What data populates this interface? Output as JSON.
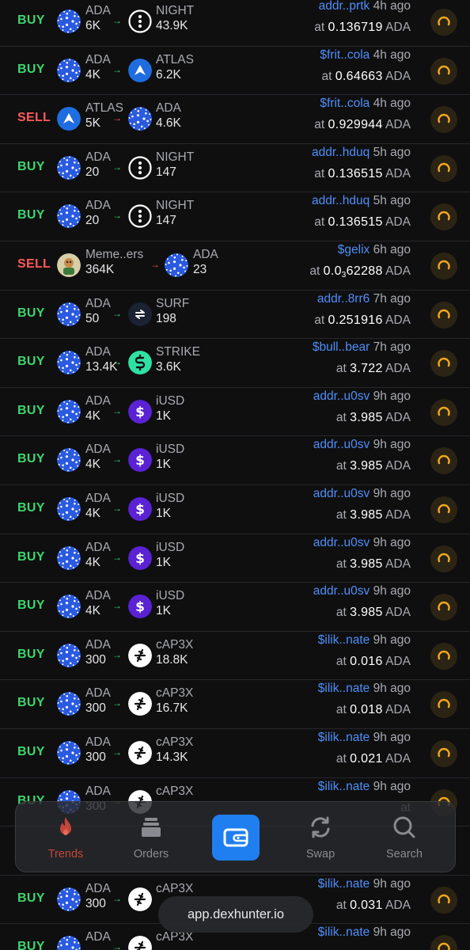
{
  "trades": [
    {
      "side": "BUY",
      "from": {
        "sym": "ADA",
        "amt": "6K",
        "icon": "ada"
      },
      "to": {
        "sym": "NIGHT",
        "amt": "43.9K",
        "icon": "night"
      },
      "addr": "addr..prtk",
      "ago": "4h ago",
      "at": "at",
      "price": "0.136719",
      "unit": "ADA"
    },
    {
      "side": "BUY",
      "from": {
        "sym": "ADA",
        "amt": "4K",
        "icon": "ada"
      },
      "to": {
        "sym": "ATLAS",
        "amt": "6.2K",
        "icon": "atlas"
      },
      "addr": "$frit..cola",
      "ago": "4h ago",
      "at": "at",
      "price": "0.64663",
      "unit": "ADA"
    },
    {
      "side": "SELL",
      "from": {
        "sym": "ATLAS",
        "amt": "5K",
        "icon": "atlas"
      },
      "to": {
        "sym": "ADA",
        "amt": "4.6K",
        "icon": "ada"
      },
      "addr": "$frit..cola",
      "ago": "4h ago",
      "at": "at",
      "price": "0.929944",
      "unit": "ADA"
    },
    {
      "side": "BUY",
      "from": {
        "sym": "ADA",
        "amt": "20",
        "icon": "ada"
      },
      "to": {
        "sym": "NIGHT",
        "amt": "147",
        "icon": "night"
      },
      "addr": "addr..hduq",
      "ago": "5h ago",
      "at": "at",
      "price": "0.136515",
      "unit": "ADA"
    },
    {
      "side": "BUY",
      "from": {
        "sym": "ADA",
        "amt": "20",
        "icon": "ada"
      },
      "to": {
        "sym": "NIGHT",
        "amt": "147",
        "icon": "night"
      },
      "addr": "addr..hduq",
      "ago": "5h ago",
      "at": "at",
      "price": "0.136515",
      "unit": "ADA"
    },
    {
      "side": "SELL",
      "from": {
        "sym": "Meme..ers",
        "amt": "364K",
        "icon": "meme"
      },
      "to": {
        "sym": "ADA",
        "amt": "23",
        "icon": "ada"
      },
      "addr": "$gelix",
      "ago": "6h ago",
      "at": "at",
      "price": "0.0",
      "price_sub": "3",
      "price_tail": "62288",
      "unit": "ADA"
    },
    {
      "side": "BUY",
      "from": {
        "sym": "ADA",
        "amt": "50",
        "icon": "ada"
      },
      "to": {
        "sym": "SURF",
        "amt": "198",
        "icon": "surf"
      },
      "addr": "addr..8rr6",
      "ago": "7h ago",
      "at": "at",
      "price": "0.251916",
      "unit": "ADA"
    },
    {
      "side": "BUY",
      "from": {
        "sym": "ADA",
        "amt": "13.4K",
        "icon": "ada"
      },
      "to": {
        "sym": "STRIKE",
        "amt": "3.6K",
        "icon": "strike"
      },
      "addr": "$bull..bear",
      "ago": "7h ago",
      "at": "at",
      "price": "3.722",
      "unit": "ADA"
    },
    {
      "side": "BUY",
      "from": {
        "sym": "ADA",
        "amt": "4K",
        "icon": "ada"
      },
      "to": {
        "sym": "iUSD",
        "amt": "1K",
        "icon": "iusd"
      },
      "addr": "addr..u0sv",
      "ago": "9h ago",
      "at": "at",
      "price": "3.985",
      "unit": "ADA"
    },
    {
      "side": "BUY",
      "from": {
        "sym": "ADA",
        "amt": "4K",
        "icon": "ada"
      },
      "to": {
        "sym": "iUSD",
        "amt": "1K",
        "icon": "iusd"
      },
      "addr": "addr..u0sv",
      "ago": "9h ago",
      "at": "at",
      "price": "3.985",
      "unit": "ADA"
    },
    {
      "side": "BUY",
      "from": {
        "sym": "ADA",
        "amt": "4K",
        "icon": "ada"
      },
      "to": {
        "sym": "iUSD",
        "amt": "1K",
        "icon": "iusd"
      },
      "addr": "addr..u0sv",
      "ago": "9h ago",
      "at": "at",
      "price": "3.985",
      "unit": "ADA"
    },
    {
      "side": "BUY",
      "from": {
        "sym": "ADA",
        "amt": "4K",
        "icon": "ada"
      },
      "to": {
        "sym": "iUSD",
        "amt": "1K",
        "icon": "iusd"
      },
      "addr": "addr..u0sv",
      "ago": "9h ago",
      "at": "at",
      "price": "3.985",
      "unit": "ADA"
    },
    {
      "side": "BUY",
      "from": {
        "sym": "ADA",
        "amt": "4K",
        "icon": "ada"
      },
      "to": {
        "sym": "iUSD",
        "amt": "1K",
        "icon": "iusd"
      },
      "addr": "addr..u0sv",
      "ago": "9h ago",
      "at": "at",
      "price": "3.985",
      "unit": "ADA"
    },
    {
      "side": "BUY",
      "from": {
        "sym": "ADA",
        "amt": "300",
        "icon": "ada"
      },
      "to": {
        "sym": "cAP3X",
        "amt": "18.8K",
        "icon": "cap3x"
      },
      "addr": "$ilik..nate",
      "ago": "9h ago",
      "at": "at",
      "price": "0.016",
      "unit": "ADA"
    },
    {
      "side": "BUY",
      "from": {
        "sym": "ADA",
        "amt": "300",
        "icon": "ada"
      },
      "to": {
        "sym": "cAP3X",
        "amt": "16.7K",
        "icon": "cap3x"
      },
      "addr": "$ilik..nate",
      "ago": "9h ago",
      "at": "at",
      "price": "0.018",
      "unit": "ADA"
    },
    {
      "side": "BUY",
      "from": {
        "sym": "ADA",
        "amt": "300",
        "icon": "ada"
      },
      "to": {
        "sym": "cAP3X",
        "amt": "14.3K",
        "icon": "cap3x"
      },
      "addr": "$ilik..nate",
      "ago": "9h ago",
      "at": "at",
      "price": "0.021",
      "unit": "ADA"
    },
    {
      "side": "BUY",
      "from": {
        "sym": "ADA",
        "amt": "300",
        "icon": "ada"
      },
      "to": {
        "sym": "cAP3X",
        "amt": "",
        "icon": "cap3x"
      },
      "addr": "$ilik..nate",
      "ago": "9h ago",
      "at": "at",
      "price": "",
      "unit": ""
    },
    {
      "side": "",
      "from": {
        "sym": "",
        "amt": "",
        "icon": ""
      },
      "to": {
        "sym": "",
        "amt": "",
        "icon": ""
      },
      "addr": "",
      "ago": "",
      "at": "",
      "price": "",
      "unit": ""
    },
    {
      "side": "BUY",
      "from": {
        "sym": "ADA",
        "amt": "300",
        "icon": "ada"
      },
      "to": {
        "sym": "cAP3X",
        "amt": "",
        "icon": "cap3x"
      },
      "addr": "$ilik..nate",
      "ago": "9h ago",
      "at": "at",
      "price": "0.031",
      "unit": "ADA"
    },
    {
      "side": "BUY",
      "from": {
        "sym": "ADA",
        "amt": "",
        "icon": "ada"
      },
      "to": {
        "sym": "cAP3X",
        "amt": "",
        "icon": "cap3x"
      },
      "addr": "$ilik..nate",
      "ago": "9h ago",
      "at": "",
      "price": "",
      "unit": ""
    }
  ],
  "nav": {
    "tabs": [
      {
        "label": "Trends",
        "icon": "flame-icon",
        "active": true
      },
      {
        "label": "Orders",
        "icon": "stack-icon",
        "active": false
      },
      {
        "label": "",
        "icon": "wallet-icon",
        "active": false
      },
      {
        "label": "Swap",
        "icon": "swap-icon",
        "active": false
      },
      {
        "label": "Search",
        "icon": "search-icon",
        "active": false
      }
    ]
  },
  "browser": {
    "url": "app.dexhunter.io"
  },
  "colors": {
    "buy": "#3ed56c",
    "sell": "#ff5a5a",
    "address": "#4f8ef7",
    "accent": "#1f7ff0",
    "trends": "#c2473a"
  }
}
